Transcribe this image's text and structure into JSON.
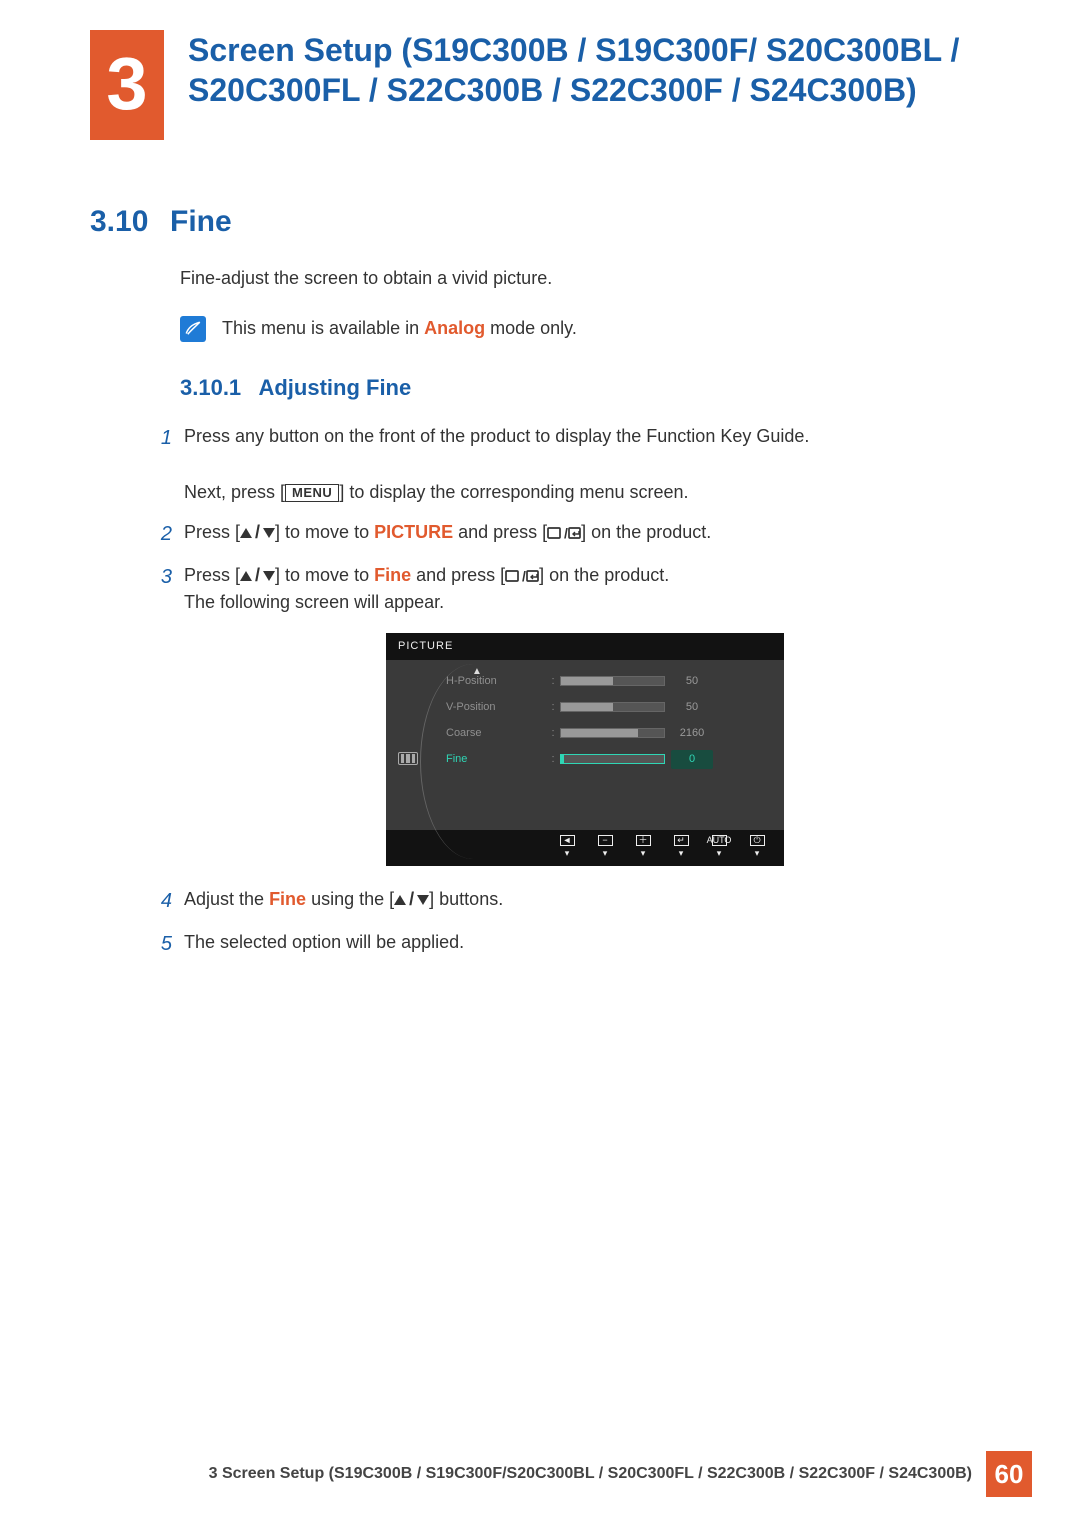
{
  "header": {
    "chapter_number": "3",
    "chapter_title": "Screen Setup (S19C300B / S19C300F/ S20C300BL / S20C300FL / S22C300B / S22C300F / S24C300B)"
  },
  "section": {
    "number": "3.10",
    "title": "Fine"
  },
  "intro": "Fine-adjust the screen to obtain a vivid picture.",
  "note": {
    "prefix": "This menu is available in ",
    "highlight": "Analog",
    "suffix": " mode only."
  },
  "subsection": {
    "number": "3.10.1",
    "title": "Adjusting Fine"
  },
  "steps": {
    "s1a": "Press any button on the front of the product to display the Function Key Guide.",
    "s1b_prefix": "Next, press [",
    "s1b_menu": "MENU",
    "s1b_suffix": "] to display the corresponding menu screen.",
    "s2_prefix": "Press [",
    "s2_mid": "] to move to ",
    "s2_hi": "PICTURE",
    "s2_mid2": " and press [",
    "s2_suffix": "] on the product.",
    "s3_prefix": "Press [",
    "s3_mid": "] to move to ",
    "s3_hi": "Fine",
    "s3_mid2": " and press [",
    "s3_suffix": "] on the product.",
    "s3_line2": "The following screen will appear.",
    "s4_prefix": "Adjust the ",
    "s4_hi": "Fine",
    "s4_mid": " using the [",
    "s4_suffix": "] buttons.",
    "s5": "The selected option will be applied."
  },
  "osd": {
    "title": "PICTURE",
    "rows": [
      {
        "label": "H-Position",
        "value": "50",
        "fill_pct": 50,
        "active": false
      },
      {
        "label": "V-Position",
        "value": "50",
        "fill_pct": 50,
        "active": false
      },
      {
        "label": "Coarse",
        "value": "2160",
        "fill_pct": 75,
        "active": false
      },
      {
        "label": "Fine",
        "value": "0",
        "fill_pct": 3,
        "active": true
      }
    ],
    "footer": [
      "◄",
      "−",
      "＋",
      "↵",
      "AUTO",
      "⏻"
    ]
  },
  "footer": {
    "text": "3 Screen Setup (S19C300B / S19C300F/S20C300BL / S20C300FL / S22C300B / S22C300F / S24C300B)",
    "page": "60"
  }
}
